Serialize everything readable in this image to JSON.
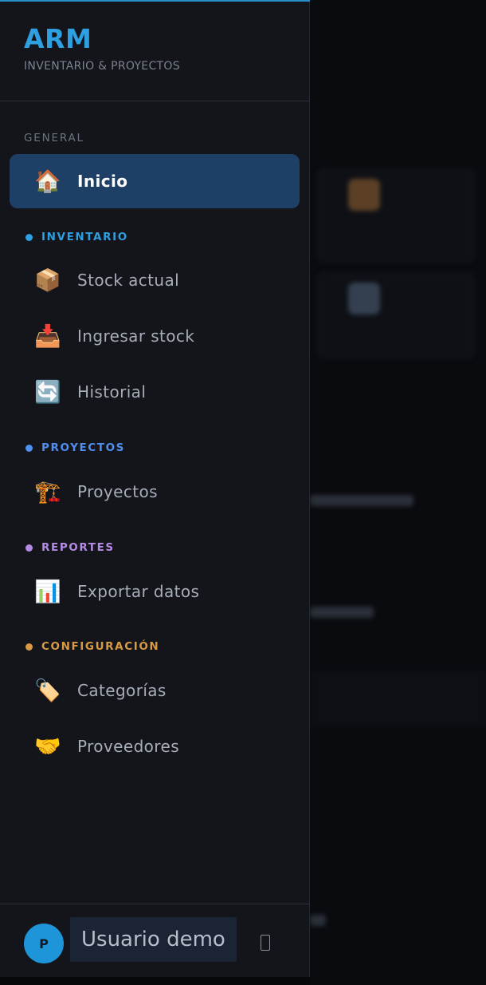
{
  "brand": {
    "title": "ARM",
    "subtitle": "INVENTARIO & PROYECTOS"
  },
  "sections": {
    "general": {
      "label": "GENERAL"
    },
    "inventario": {
      "label": "INVENTARIO",
      "color": "#2e9fe0"
    },
    "proyectos": {
      "label": "PROYECTOS",
      "color": "#4f8ff0"
    },
    "reportes": {
      "label": "REPORTES",
      "color": "#b58be6"
    },
    "configuracion": {
      "label": "CONFIGURACIÓN",
      "color": "#d99a45"
    }
  },
  "nav": {
    "inicio": {
      "label": "Inicio",
      "icon": "🏠",
      "icon_name": "house-icon",
      "active": true
    },
    "stock_actual": {
      "label": "Stock actual",
      "icon": "📦",
      "icon_name": "package-icon"
    },
    "ingresar_stock": {
      "label": "Ingresar stock",
      "icon": "📥",
      "icon_name": "inbox-tray-icon"
    },
    "historial": {
      "label": "Historial",
      "icon": "🔄",
      "icon_name": "refresh-icon"
    },
    "proyectos": {
      "label": "Proyectos",
      "icon": "🏗️",
      "icon_name": "crane-icon"
    },
    "exportar_datos": {
      "label": "Exportar datos",
      "icon": "📊",
      "icon_name": "bar-chart-icon"
    },
    "categorias": {
      "label": "Categorías",
      "icon": "🏷️",
      "icon_name": "label-tag-icon"
    },
    "proveedores": {
      "label": "Proveedores",
      "icon": "🤝",
      "icon_name": "handshake-icon"
    }
  },
  "user": {
    "initial": "P",
    "name": "Usuario demo",
    "logout_icon": "logout-icon"
  },
  "colors": {
    "accent": "#2e9fe0",
    "active_bg": "#1e3f66",
    "sidebar_bg": "#13151b"
  }
}
